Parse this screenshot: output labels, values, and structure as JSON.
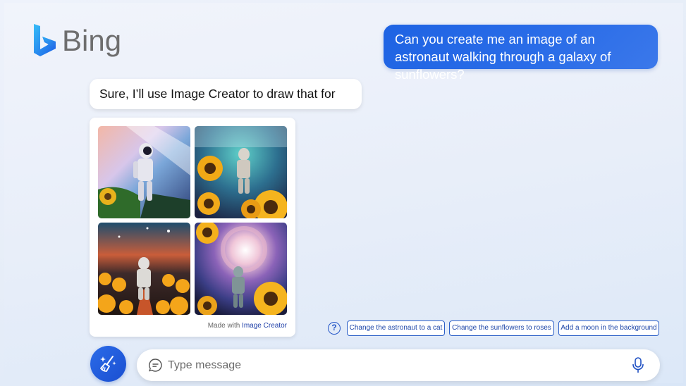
{
  "brand": {
    "name": "Bing",
    "logo_icon": "bing-b-logo",
    "accent": "#1e63e3"
  },
  "conversation": {
    "user_message": "Can you create me an image of an astronaut walking through a galaxy of sunflowers?",
    "bot_message": "Sure, I’ll use Image Creator to draw that for you."
  },
  "images": {
    "alt": [
      "astronaut in galaxy 1",
      "astronaut in galaxy 2",
      "astronaut in galaxy 3",
      "astronaut in galaxy 4"
    ],
    "made_with_prefix": "Made with",
    "made_with_link": "Image Creator"
  },
  "suggestions": {
    "help_icon": "?",
    "items": [
      "Change the astronaut to a cat",
      "Change the sunflowers to roses",
      "Add a moon in the background"
    ]
  },
  "composer": {
    "placeholder": "Type message",
    "new_topic_icon": "broom-sparkle-icon",
    "chat_icon": "chat-bubble-icon",
    "mic_icon": "microphone-icon"
  }
}
